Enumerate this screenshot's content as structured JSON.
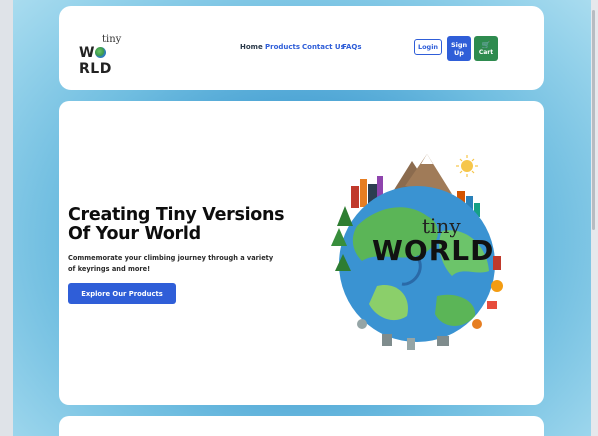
{
  "brand": {
    "logo_tiny": "tiny",
    "logo_world_pre": "W",
    "logo_world_post": "RLD"
  },
  "nav": {
    "home": "Home",
    "products": "Products",
    "contact": "Contact Us",
    "faqs": "FAQs"
  },
  "auth": {
    "login": "Login",
    "signup": "Sign Up",
    "cart": "Cart",
    "cart_icon": "cart-icon"
  },
  "hero": {
    "title": "Creating Tiny Versions Of Your World",
    "subtitle": "Commemorate your climbing journey through a variety of keyrings and more!",
    "cta": "Explore Our Products",
    "illustration_tiny": "tiny",
    "illustration_world": "WORLD"
  },
  "colors": {
    "accent": "#2f5ed8",
    "cart": "#2e8b4f",
    "background": "#3f9ad0"
  }
}
